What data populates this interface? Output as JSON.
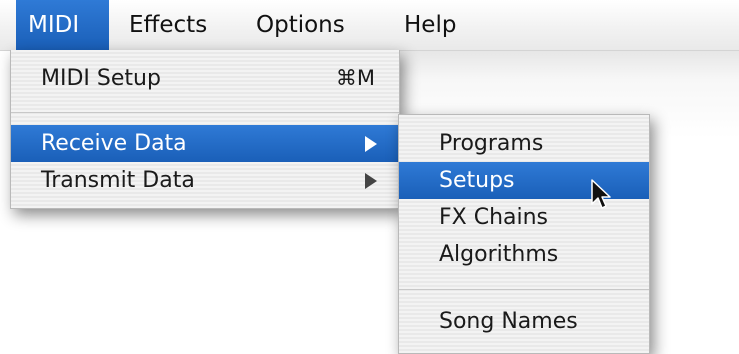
{
  "menubar": {
    "items": [
      {
        "label": "MIDI",
        "active": true
      },
      {
        "label": "Effects",
        "active": false
      },
      {
        "label": "Options",
        "active": false
      },
      {
        "label": "Help",
        "active": false
      }
    ]
  },
  "midi_menu": {
    "items": [
      {
        "label": "MIDI Setup",
        "shortcut": "⌘M"
      },
      {
        "label": "Receive Data",
        "has_submenu": true,
        "highlighted": true
      },
      {
        "label": "Transmit Data",
        "has_submenu": true
      }
    ]
  },
  "receive_submenu": {
    "items": [
      {
        "label": "Programs"
      },
      {
        "label": "Setups",
        "highlighted": true
      },
      {
        "label": "FX Chains"
      },
      {
        "label": "Algorithms"
      },
      {
        "label": "Song Names"
      }
    ]
  },
  "colors": {
    "highlight": "#1f6cc8",
    "menu_background": "#efefef"
  },
  "icons": {
    "cursor": "arrow-pointer-icon",
    "submenu": "triangle-right-icon"
  }
}
